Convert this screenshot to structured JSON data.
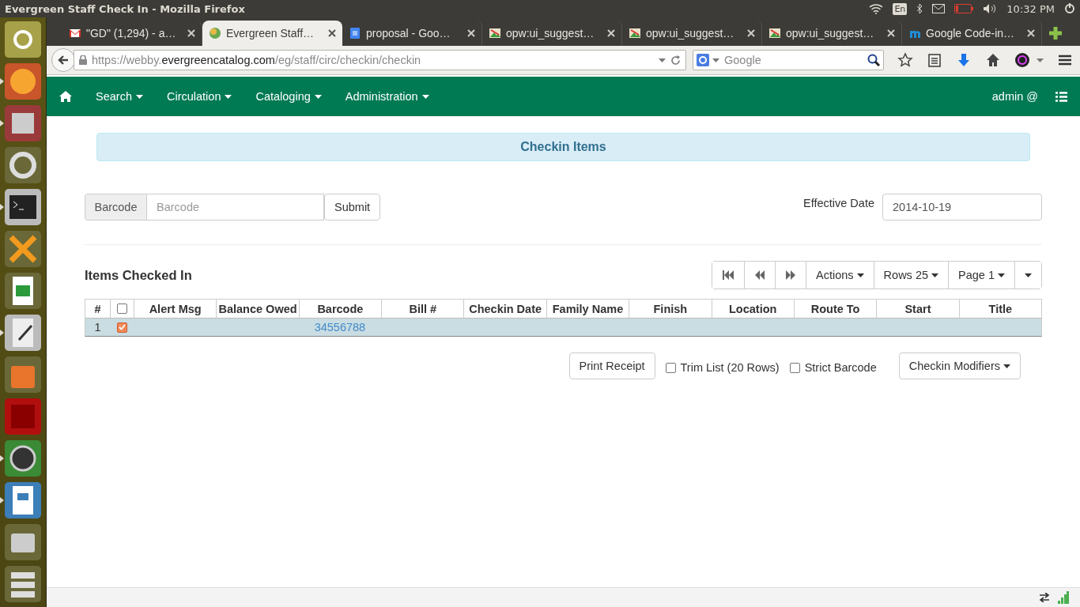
{
  "os_bar": {
    "title": "Evergreen Staff Check In - Mozilla Firefox",
    "keyboard": "En",
    "clock": "10:32 PM"
  },
  "launcher": [
    {
      "kind": "ubuntu",
      "running": false
    },
    {
      "kind": "firefox",
      "running": true
    },
    {
      "kind": "files",
      "running": true
    },
    {
      "kind": "settings",
      "running": false
    },
    {
      "kind": "terminal",
      "running": true
    },
    {
      "kind": "chat",
      "running": false
    },
    {
      "kind": "spreadsheet",
      "running": false
    },
    {
      "kind": "editor",
      "running": true
    },
    {
      "kind": "store",
      "running": false
    },
    {
      "kind": "ftp",
      "running": false
    },
    {
      "kind": "updater",
      "running": true
    },
    {
      "kind": "presentation",
      "running": true
    },
    {
      "kind": "disk",
      "running": false
    },
    {
      "kind": "stack",
      "running": false
    }
  ],
  "browser": {
    "tabs": [
      {
        "title": "\"GD\" (1,294) - a…",
        "selected": false
      },
      {
        "title": "Evergreen Staff…",
        "selected": true
      },
      {
        "title": "proposal - Goo…",
        "selected": false
      },
      {
        "title": "opw:ui_suggest…",
        "selected": false
      },
      {
        "title": "opw:ui_suggest…",
        "selected": false
      },
      {
        "title": "opw:ui_suggest…",
        "selected": false
      },
      {
        "title": "Google Code-in…",
        "selected": false
      }
    ],
    "url": {
      "host_start": "https://webby.",
      "domain": "evergreencatalog.com",
      "path": "/eg/staff/circ/checkin/checkin"
    },
    "search_placeholder": "Google"
  },
  "navbar": {
    "menus": [
      "Search",
      "Circulation",
      "Cataloging",
      "Administration"
    ],
    "user": "admin @"
  },
  "page": {
    "title": "Checkin Items",
    "barcode_label": "Barcode",
    "barcode_placeholder": "Barcode",
    "submit": "Submit",
    "effective_date_label": "Effective Date",
    "effective_date": "2014-10-19",
    "section_title": "Items Checked In",
    "grid_menus": [
      "Actions",
      "Rows 25",
      "Page 1"
    ],
    "columns": [
      {
        "kind": "index",
        "label": "#"
      },
      {
        "kind": "select",
        "checked": false
      },
      {
        "kind": "text",
        "label": "Alert Msg"
      },
      {
        "kind": "text",
        "label": "Balance Owed"
      },
      {
        "kind": "barcode",
        "label": "Barcode"
      },
      {
        "kind": "text",
        "label": "Bill #"
      },
      {
        "kind": "text",
        "label": "Checkin Date"
      },
      {
        "kind": "text",
        "label": "Family Name"
      },
      {
        "kind": "text",
        "label": "Finish"
      },
      {
        "kind": "text",
        "label": "Location"
      },
      {
        "kind": "text",
        "label": "Route To"
      },
      {
        "kind": "text",
        "label": "Start"
      },
      {
        "kind": "text",
        "label": "Title"
      }
    ],
    "rows": [
      {
        "index": "1",
        "selected": true,
        "barcode": "34556788"
      }
    ],
    "print_receipt": "Print Receipt",
    "options": [
      {
        "label": "Trim List (20 Rows)",
        "checked": false
      },
      {
        "label": "Strict Barcode",
        "checked": false
      }
    ],
    "modifiers": "Checkin Modifiers"
  }
}
